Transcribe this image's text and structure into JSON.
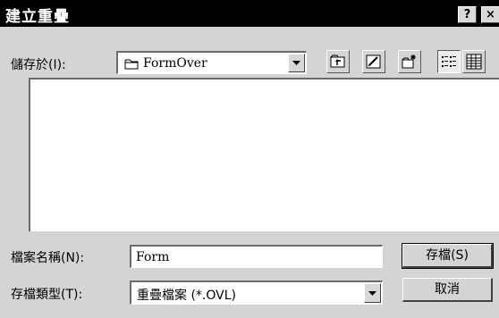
{
  "window": {
    "title": "建立重疊",
    "help_label": "?",
    "close_label": "×"
  },
  "save_in": {
    "label": "儲存於(I):",
    "value": "FormOver",
    "icon": "folder-icon"
  },
  "toolbar": {
    "buttons": [
      {
        "name": "up-one-level",
        "icon": "up-folder-icon"
      },
      {
        "name": "desktop",
        "icon": "desktop-icon"
      },
      {
        "name": "create-new-folder",
        "icon": "new-folder-icon"
      },
      {
        "name": "list-view",
        "icon": "list-view-icon",
        "pressed": true
      },
      {
        "name": "details-view",
        "icon": "details-view-icon"
      }
    ]
  },
  "file_list": {
    "items": []
  },
  "filename": {
    "label": "檔案名稱(N):",
    "value": "Form"
  },
  "filetype": {
    "label": "存檔類型(T):",
    "value": "重疊檔案 (*.OVL)"
  },
  "buttons": {
    "save": "存檔(S)",
    "cancel": "取消"
  }
}
